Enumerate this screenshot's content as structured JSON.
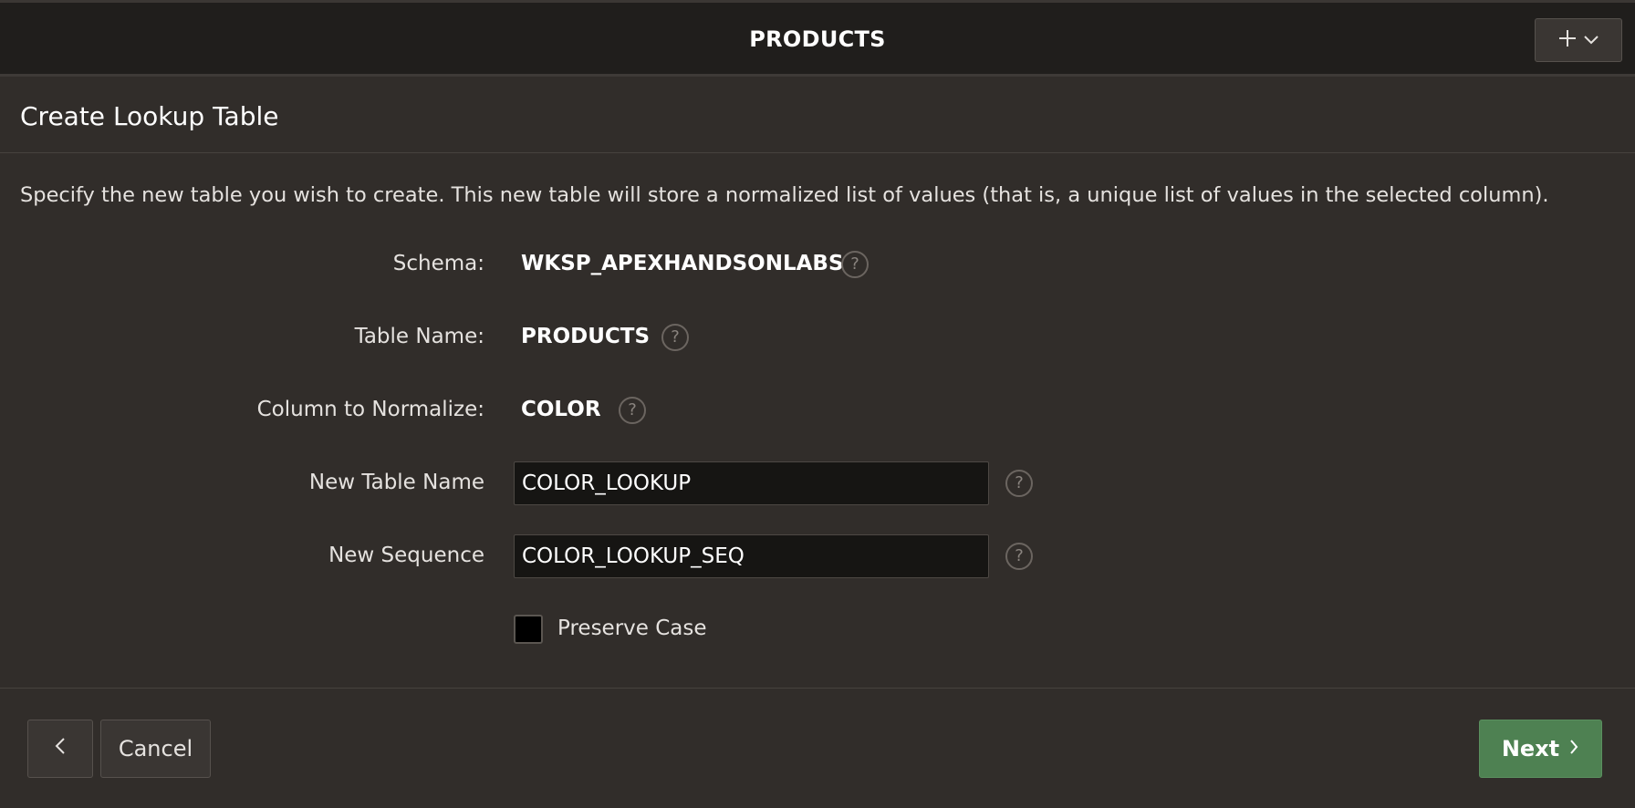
{
  "topbar": {
    "title": "PRODUCTS",
    "add_icon": "plus-icon",
    "menu_icon": "chevron-down-icon"
  },
  "section": {
    "heading": "Create Lookup Table"
  },
  "intro": "Specify the new table you wish to create. This new table will store a normalized list of values (that is, a unique list of values in the selected column).",
  "fields": {
    "schema": {
      "label": "Schema:",
      "value": "WKSP_APEXHANDSONLABS"
    },
    "table_name": {
      "label": "Table Name:",
      "value": "PRODUCTS"
    },
    "column": {
      "label": "Column to Normalize:",
      "value": "COLOR"
    },
    "new_table_name": {
      "label": "New Table Name",
      "value": "COLOR_LOOKUP"
    },
    "new_sequence": {
      "label": "New Sequence",
      "value": "COLOR_LOOKUP_SEQ"
    },
    "preserve_case": {
      "label": "Preserve Case",
      "checked": false
    }
  },
  "help_glyph": "?",
  "footer": {
    "back_icon": "chevron-left-icon",
    "cancel_label": "Cancel",
    "next_label": "Next",
    "next_icon": "chevron-right-icon"
  },
  "colors": {
    "background": "#312d2a",
    "topbar": "#201e1c",
    "next_button": "#4e8152"
  }
}
